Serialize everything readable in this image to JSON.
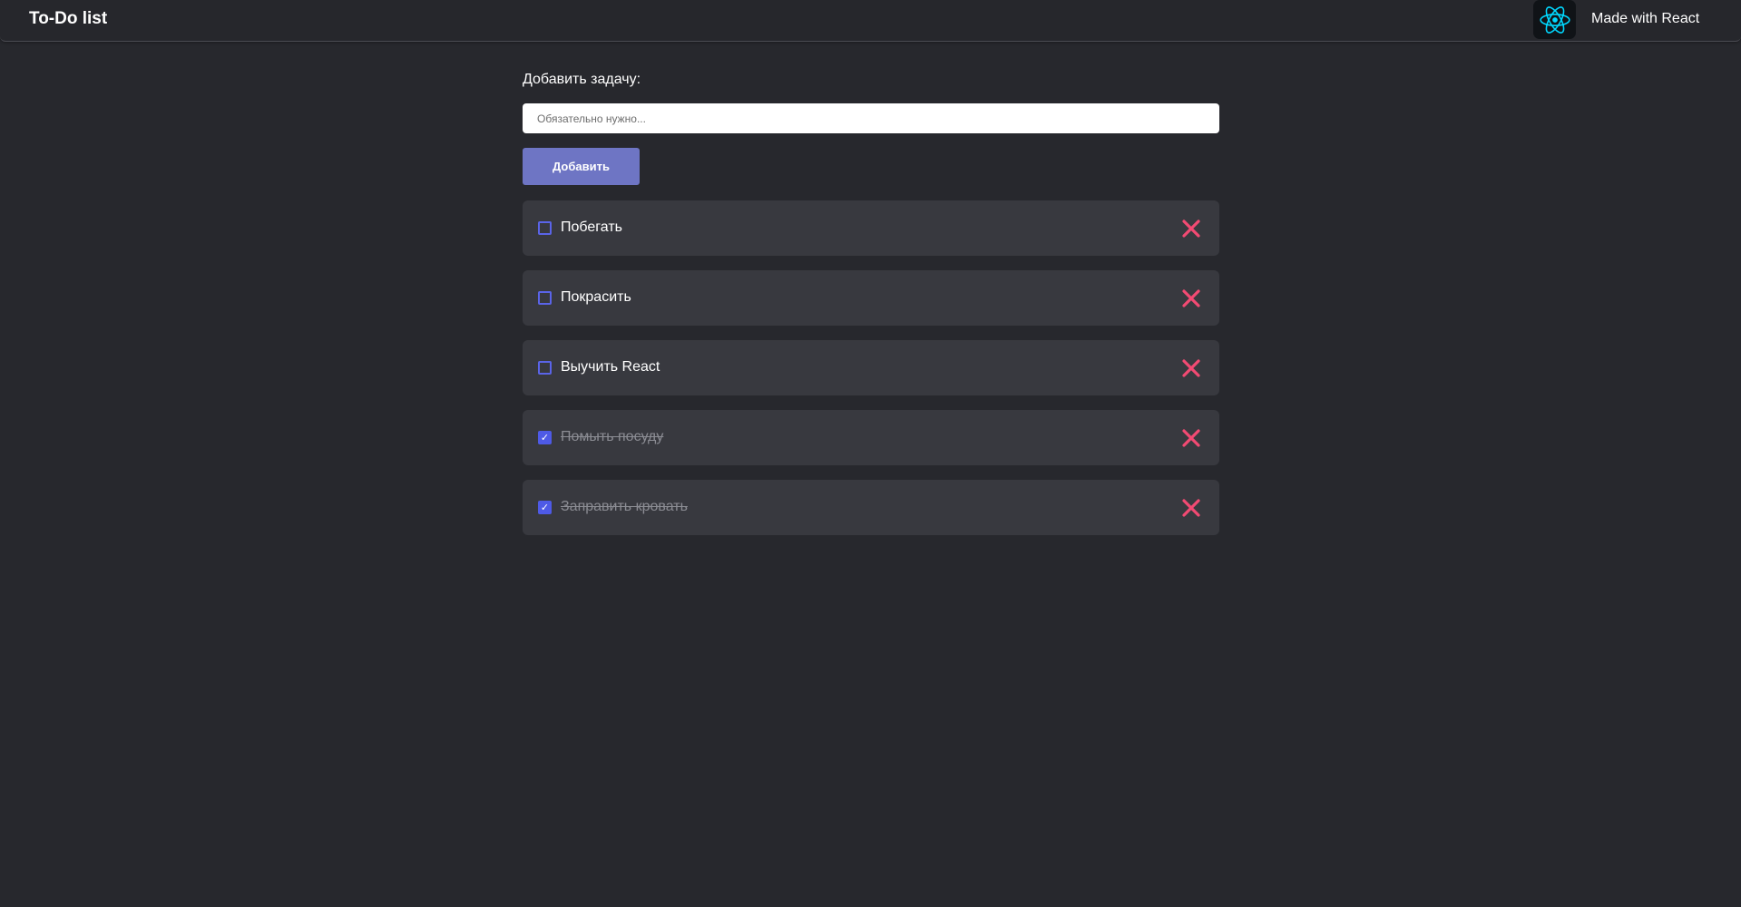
{
  "header": {
    "title": "To-Do list",
    "made_with": "Made with React",
    "logo_icon": "react-logo-icon"
  },
  "form": {
    "label": "Добавить задачу:",
    "input_placeholder": "Обязательно нужно...",
    "input_value": "",
    "add_button_label": "Добавить"
  },
  "tasks": [
    {
      "text": "Побегать",
      "done": false
    },
    {
      "text": "Покрасить",
      "done": false
    },
    {
      "text": "Выучить React",
      "done": false
    },
    {
      "text": "Помыть посуду",
      "done": true
    },
    {
      "text": "Заправить кровать",
      "done": true
    }
  ],
  "colors": {
    "background": "#27282d",
    "task_background": "#38393f",
    "accent": "#6e75c4",
    "checkbox": "#4e5ae6",
    "delete": "#f24a73",
    "react": "#00d8ff"
  }
}
